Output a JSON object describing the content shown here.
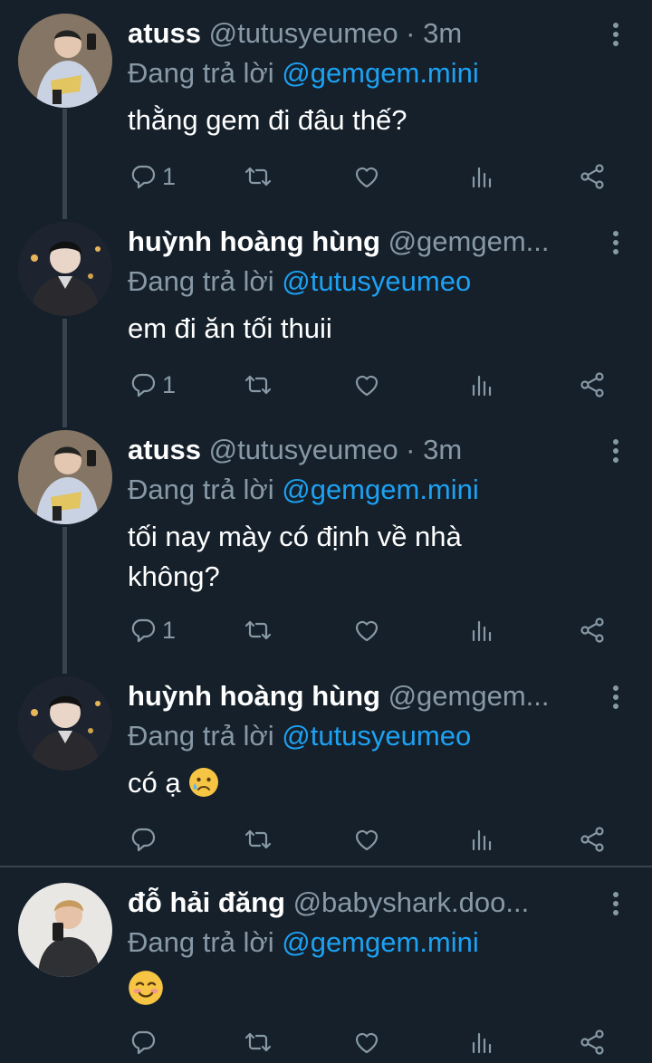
{
  "tweets": [
    {
      "name": "atuss",
      "handle": "@tutusyeumeo · 3m",
      "reply_prefix": "Đang trả lời ",
      "reply_to": "@gemgem.mini",
      "text_lines": [
        "thằng gem đi đâu thế?"
      ],
      "reply_count": "1",
      "avatar_icon": "atuss-avatar"
    },
    {
      "name": "huỳnh hoàng hùng",
      "handle": "@gemgem...",
      "reply_prefix": "Đang trả lời ",
      "reply_to": "@tutusyeumeo",
      "text_lines": [
        "em đi ăn tối thuii"
      ],
      "reply_count": "1",
      "avatar_icon": "hung-avatar"
    },
    {
      "name": "atuss",
      "handle": "@tutusyeumeo · 3m",
      "reply_prefix": "Đang trả lời ",
      "reply_to": "@gemgem.mini",
      "text_lines": [
        "tối nay mày có định về nhà",
        "không?"
      ],
      "reply_count": "1",
      "avatar_icon": "atuss-avatar"
    },
    {
      "name": "huỳnh hoàng hùng",
      "handle": "@gemgem...",
      "reply_prefix": "Đang trả lời ",
      "reply_to": "@tutusyeumeo",
      "text": "có ạ",
      "text_emoji": "sad-relieved-emoji",
      "reply_count": "",
      "avatar_icon": "hung-avatar"
    },
    {
      "name": "đỗ hải đăng",
      "handle": "@babyshark.doo...",
      "reply_prefix": "Đang trả lời ",
      "reply_to": "@gemgem.mini",
      "text_emoji": "smiling-blush-emoji",
      "reply_count": "",
      "avatar_icon": "dang-avatar"
    }
  ],
  "icons": {
    "reply": "reply-icon",
    "retweet": "retweet-icon",
    "like": "heart-icon",
    "stats": "analytics-icon",
    "share": "share-icon",
    "more": "more-vertical-icon"
  },
  "colors": {
    "background": "#15202b",
    "text": "#ffffff",
    "muted": "#8899a6",
    "mention": "#1da1f2",
    "divider": "#38444d"
  }
}
